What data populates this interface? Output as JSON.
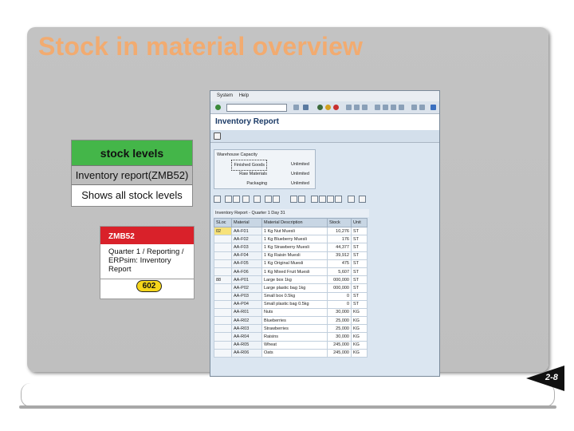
{
  "slide": {
    "title": "Stock in material overview",
    "number": "2-8"
  },
  "stock_levels": {
    "header": "stock levels",
    "report": "Inventory report(ZMB52)",
    "description": "Shows all stock levels",
    "colors": {
      "header": "#44b649",
      "mid": "#bdbdbd"
    }
  },
  "zmb_card": {
    "code": "ZMB52",
    "path": "Quarter 1 / Reporting / ERPsim: Inventory Report",
    "badge": "602",
    "colors": {
      "header": "#d9212a",
      "badge": "#f6d51b"
    }
  },
  "sap_window": {
    "menu": [
      "System",
      "Help"
    ],
    "title": "Inventory Report",
    "warehouse": {
      "heading": "Warehouse Capacity",
      "rows": [
        {
          "label": "Finished Goods",
          "value": "Unlimited"
        },
        {
          "label": "Raw Materials",
          "value": "Unlimited"
        },
        {
          "label": "Packaging",
          "value": "Unlimited"
        }
      ]
    },
    "grid": {
      "title": "Inventory Report - Quarter 1 Day 31",
      "columns": [
        "SLoc",
        "Material",
        "Material Description",
        "Stock",
        "Unit"
      ],
      "rows": [
        {
          "sloc": "02",
          "material": "AA-F01",
          "description": "1 Kg Nut Muesli",
          "stock": "10,276",
          "unit": "ST"
        },
        {
          "sloc": "",
          "material": "AA-F02",
          "description": "1 Kg Blueberry Muesli",
          "stock": "176",
          "unit": "ST"
        },
        {
          "sloc": "",
          "material": "AA-F03",
          "description": "1 Kg Strawberry Muesli",
          "stock": "44,377",
          "unit": "ST"
        },
        {
          "sloc": "",
          "material": "AA-F04",
          "description": "1 Kg Raisin Muesli",
          "stock": "39,912",
          "unit": "ST"
        },
        {
          "sloc": "",
          "material": "AA-F05",
          "description": "1 Kg Original Muesli",
          "stock": "475",
          "unit": "ST"
        },
        {
          "sloc": "",
          "material": "AA-F06",
          "description": "1 Kg Mixed Fruit Muesli",
          "stock": "5,607",
          "unit": "ST"
        },
        {
          "sloc": "88",
          "material": "AA-P01",
          "description": "Large box 1kg",
          "stock": "000,000",
          "unit": "ST"
        },
        {
          "sloc": "",
          "material": "AA-P02",
          "description": "Large plastic bag 1kg",
          "stock": "000,000",
          "unit": "ST"
        },
        {
          "sloc": "",
          "material": "AA-P03",
          "description": "Small box 0.5kg",
          "stock": "0",
          "unit": "ST"
        },
        {
          "sloc": "",
          "material": "AA-P04",
          "description": "Small plastic bag 0.5kg",
          "stock": "0",
          "unit": "ST"
        },
        {
          "sloc": "",
          "material": "AA-R01",
          "description": "Nuts",
          "stock": "30,000",
          "unit": "KG"
        },
        {
          "sloc": "",
          "material": "AA-R02",
          "description": "Blueberries",
          "stock": "25,000",
          "unit": "KG"
        },
        {
          "sloc": "",
          "material": "AA-R03",
          "description": "Strawberries",
          "stock": "25,000",
          "unit": "KG"
        },
        {
          "sloc": "",
          "material": "AA-R04",
          "description": "Raisins",
          "stock": "30,000",
          "unit": "KG"
        },
        {
          "sloc": "",
          "material": "AA-R05",
          "description": "Wheat",
          "stock": "245,000",
          "unit": "KG"
        },
        {
          "sloc": "",
          "material": "AA-R06",
          "description": "Oats",
          "stock": "245,000",
          "unit": "KG"
        }
      ]
    }
  },
  "colors": {
    "title": "#f2ab70",
    "panel": "#c1c1c1",
    "sap_title": "#1a3a66"
  }
}
